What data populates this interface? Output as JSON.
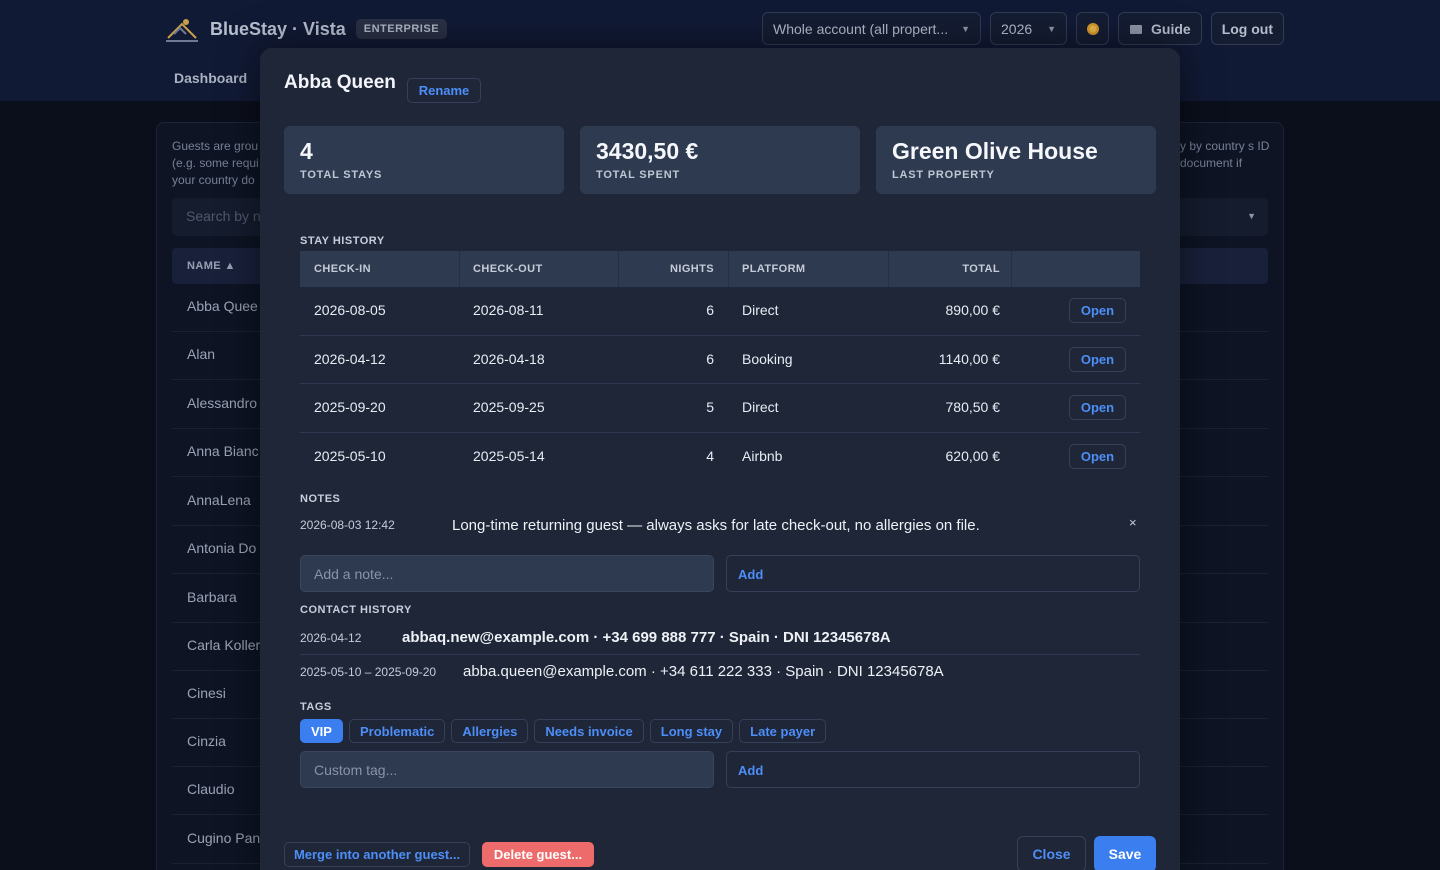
{
  "app": {
    "brand": "BlueStay · Vista",
    "badge": "ENTERPRISE",
    "nav_dashboard": "Dashboard",
    "property_select": "Whole account (all propert...",
    "year": "2026",
    "guide_label": "Guide",
    "logout_label": "Log out"
  },
  "background": {
    "intro_left": "Guests are grou (e.g. some requi your country do",
    "intro_right": "y by country s ID document if",
    "search_placeholder": "Search by n",
    "name_header": "NAME ▲",
    "guests": [
      "Abba Quee",
      "Alan",
      "Alessandro",
      "Anna Bianc",
      "AnnaLena",
      "Antonia Do",
      "Barbara",
      "Carla Koller",
      "Cinesi",
      "Cinzia",
      "Claudio",
      "Cugino Pan"
    ]
  },
  "modal": {
    "title": "Abba Queen",
    "rename_label": "Rename",
    "stats": [
      {
        "value": "4",
        "label": "TOTAL STAYS"
      },
      {
        "value": "3430,50 €",
        "label": "TOTAL SPENT"
      },
      {
        "value": "Green Olive House",
        "label": "LAST PROPERTY"
      }
    ],
    "stay_history_title": "STAY HISTORY",
    "stay_columns": {
      "checkin": "CHECK-IN",
      "checkout": "CHECK-OUT",
      "nights": "NIGHTS",
      "platform": "PLATFORM",
      "total": "TOTAL"
    },
    "stays": [
      {
        "checkin": "2026-08-05",
        "checkout": "2026-08-11",
        "nights": "6",
        "platform": "Direct",
        "total": "890,00 €",
        "action": "Open"
      },
      {
        "checkin": "2026-04-12",
        "checkout": "2026-04-18",
        "nights": "6",
        "platform": "Booking",
        "total": "1140,00 €",
        "action": "Open"
      },
      {
        "checkin": "2025-09-20",
        "checkout": "2025-09-25",
        "nights": "5",
        "platform": "Direct",
        "total": "780,50 €",
        "action": "Open"
      },
      {
        "checkin": "2025-05-10",
        "checkout": "2025-05-14",
        "nights": "4",
        "platform": "Airbnb",
        "total": "620,00 €",
        "action": "Open"
      }
    ],
    "notes_title": "NOTES",
    "notes": [
      {
        "timestamp": "2026-08-03 12:42",
        "text": "Long-time returning guest — always asks for late check-out, no allergies on file.",
        "remove": "×"
      }
    ],
    "note_placeholder": "Add a note...",
    "note_add_label": "Add",
    "contact_title": "CONTACT HISTORY",
    "contacts": [
      {
        "period": "2026-04-12",
        "details": "abbaq.new@example.com · +34 699 888 777 · Spain · DNI 12345678A"
      },
      {
        "period": "2025-05-10 – 2025-09-20",
        "details": "abba.queen@example.com · +34 611 222 333 · Spain · DNI 12345678A"
      }
    ],
    "tags_title": "TAGS",
    "tags": [
      "VIP",
      "Problematic",
      "Allergies",
      "Needs invoice",
      "Long stay",
      "Late payer"
    ],
    "tag_placeholder": "Custom tag...",
    "tag_add_label": "Add",
    "merge_label": "Merge into another guest...",
    "delete_label": "Delete guest...",
    "close_label": "Close",
    "save_label": "Save"
  },
  "colors": {
    "accent": "#3b7ef0",
    "danger": "#ee6b6b",
    "modal_bg": "#1e2638",
    "page_bg": "#0b0f1c"
  }
}
